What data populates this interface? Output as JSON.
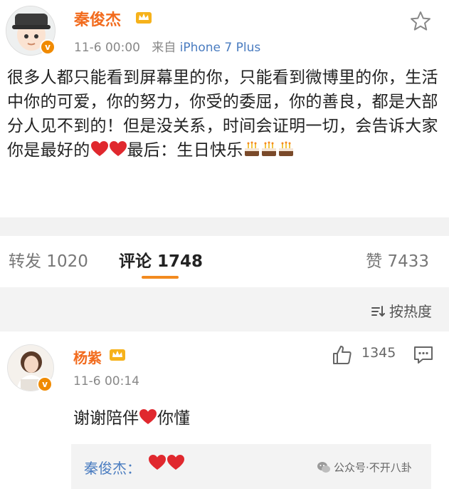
{
  "post": {
    "author": "秦俊杰",
    "timestamp": "11-6 00:00",
    "source_prefix": "来自",
    "device": "iPhone 7 Plus",
    "body_text": "很多人都只能看到屏幕里的你，只能看到微博里的你，生活中你的可爱，你的努力，你受的委屈，你的善良，都是大部分人见不到的！但是没关系，时间会证明一切，会告诉大家你是最好的",
    "body_suffix": "最后：生日快乐",
    "badge_letter": "v",
    "icons": [
      "avatar",
      "verified-badge-icon",
      "crown-icon",
      "star-icon",
      "heart-icon",
      "cake-icon"
    ]
  },
  "tabs": {
    "repost": "转发 1020",
    "comment": "评论 1748",
    "like": "赞 7433"
  },
  "sort": {
    "label": "按热度",
    "icon": "sort-icon"
  },
  "comment": {
    "author": "杨紫",
    "timestamp": "11-6 00:14",
    "like_count": "1345",
    "text_before": "谢谢陪伴",
    "text_after": "你懂",
    "badge_letter": "v",
    "icons": [
      "avatar",
      "verified-badge-icon",
      "crown-icon",
      "thumbs-up-icon",
      "reply-icon",
      "heart-icon"
    ]
  },
  "reply": {
    "author": "秦俊杰："
  },
  "watermark": {
    "text": "公众号·不开八卦",
    "icon": "wechat-icon"
  },
  "colors": {
    "name_orange": "#f26b1d",
    "link_blue": "#4a7cc0",
    "heart_red": "#e0282e",
    "underline_orange": "#f28a1f",
    "badge_orange": "#f08a00"
  }
}
